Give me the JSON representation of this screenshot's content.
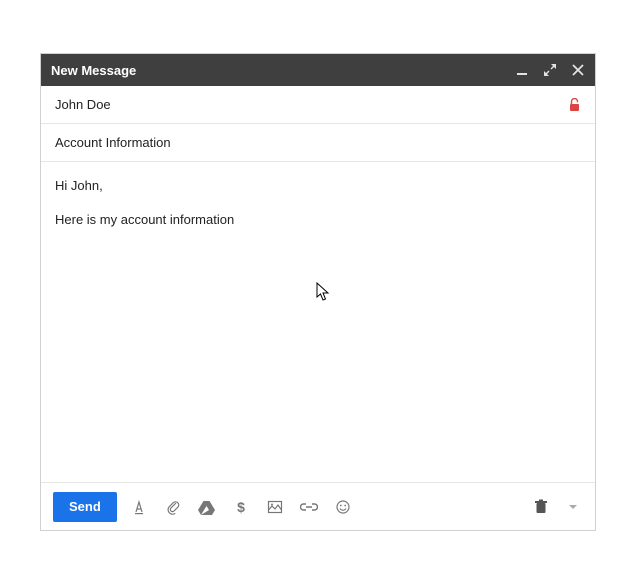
{
  "titlebar": {
    "title": "New Message"
  },
  "fields": {
    "to": "John Doe",
    "subject": "Account Information"
  },
  "body": {
    "line1": "Hi John,",
    "line2": "Here is my account information"
  },
  "toolbar": {
    "send_label": "Send"
  },
  "icons": {
    "minimize": "minimize",
    "expand": "expand",
    "close": "close",
    "lock": "lock",
    "format": "format",
    "attach": "attach",
    "drive": "drive",
    "dollar": "dollar",
    "image": "image",
    "link": "link",
    "emoji": "emoji",
    "trash": "trash",
    "more": "more"
  }
}
